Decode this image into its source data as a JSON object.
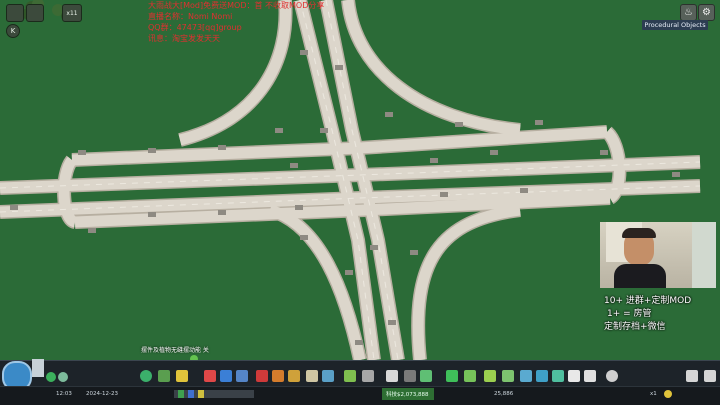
{
  "overlay": {
    "lines": [
      "大雨战大[Mod]免费送MOD：首 不收取MOD分享",
      "直播名称：Nomi Nomi",
      "QQ群：47473[qq]group",
      "讯息：淘宝发发天天"
    ]
  },
  "top_left": {
    "btn1": "",
    "btn2": "",
    "speed_label": "x11",
    "k_label": "K"
  },
  "top_right": {
    "procedural_objects_label": "Procedural Objects",
    "icon_a": "♨",
    "icon_b": "⚙"
  },
  "stream": {
    "line1": "10+ 进群+定制MOD",
    "line2": "1+ = 房管",
    "line3": "定制存档+微信"
  },
  "toast": "摆件及植物无缝摆动能 关",
  "status": {
    "date_left": "12:03",
    "date_right": "2024-12-23",
    "money": "科技$2,073,888",
    "population": "25,886",
    "speed": "x1"
  },
  "colors": {
    "grass": "#2b6b37",
    "road": "#dcd6cb",
    "road_edge": "#b7afa1",
    "pillar": "#8e8a82"
  }
}
